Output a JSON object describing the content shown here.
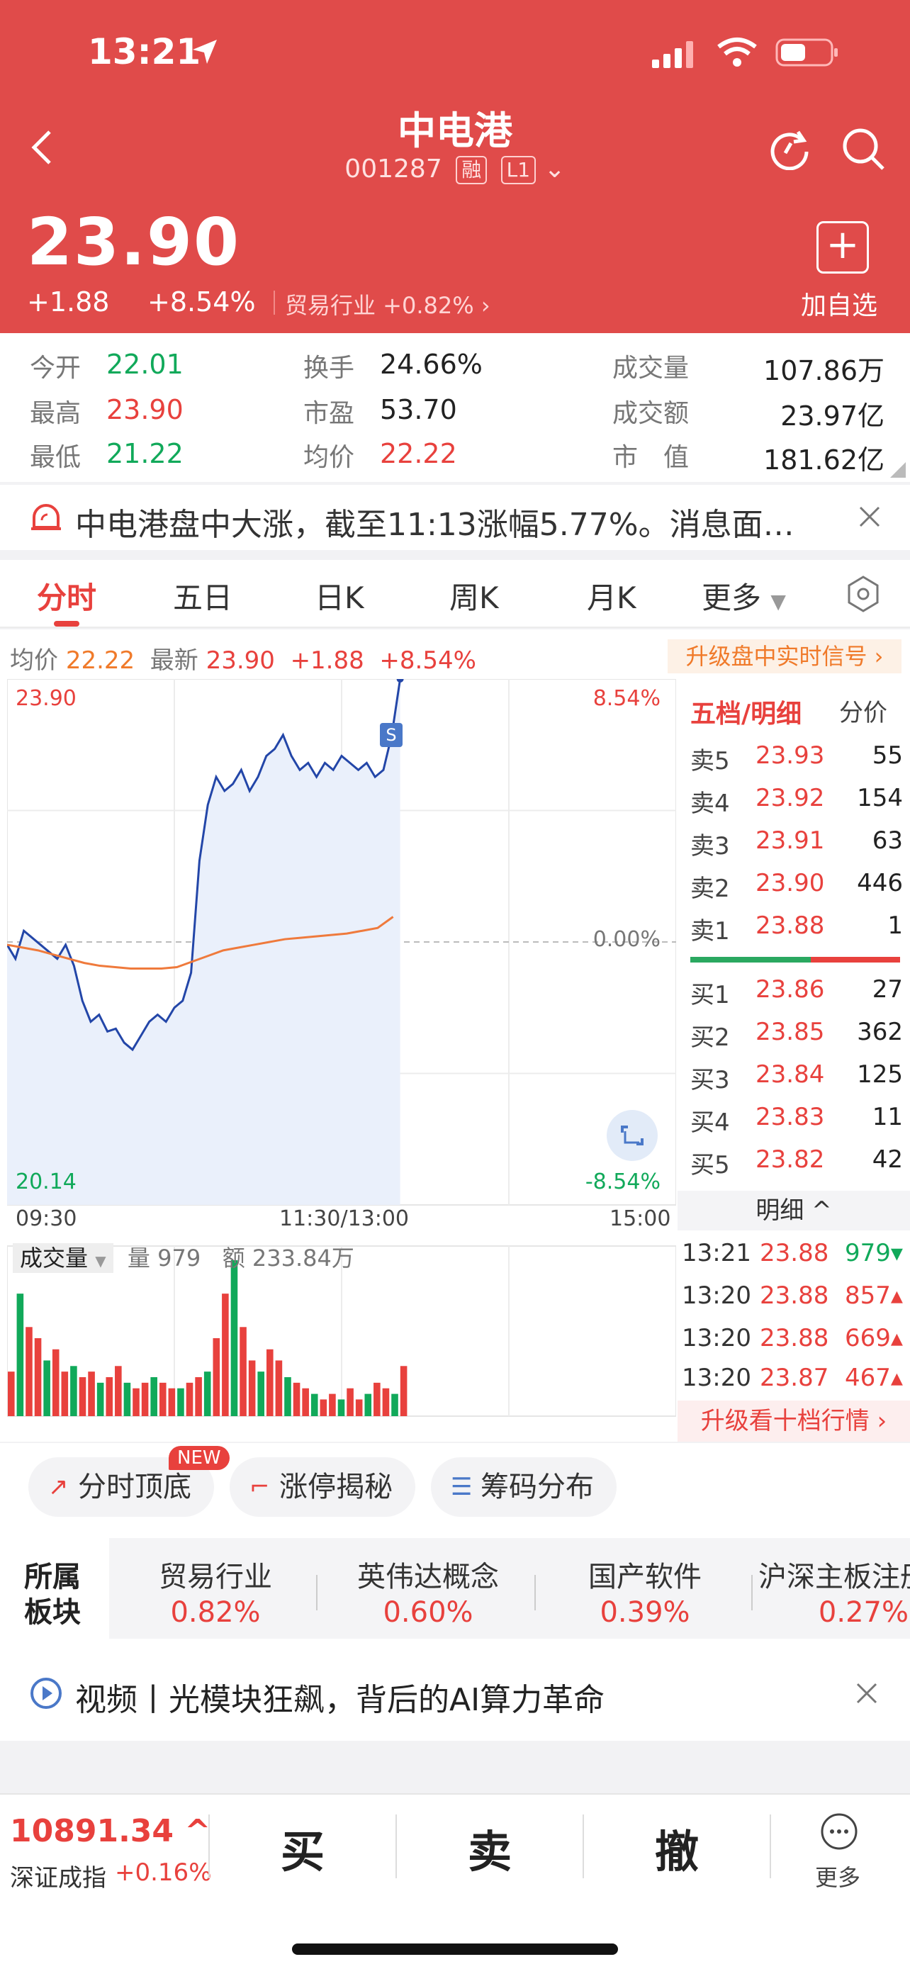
{
  "status_bar": {
    "time": "13:21"
  },
  "header": {
    "title": "中电港",
    "code": "001287",
    "tag_margin": "融",
    "tag_level": "L1",
    "price": "23.90",
    "change": "+1.88",
    "change_pct": "+8.54%",
    "industry_link": "贸易行业 +0.82% ›",
    "add_fav": "加自选"
  },
  "stats": {
    "open_label": "今开",
    "open": "22.01",
    "high_label": "最高",
    "high": "23.90",
    "low_label": "最低",
    "low": "21.22",
    "turnover_label": "换手",
    "turnover": "24.66%",
    "pe_label": "市盈",
    "pe": "53.70",
    "avg_label": "均价",
    "avg": "22.22",
    "volume_label": "成交量",
    "volume": "107.86万",
    "amount_label": "成交额",
    "amount": "23.97亿",
    "mcap_label": "市　值",
    "mcap": "181.62亿"
  },
  "news": {
    "text": "中电港盘中大涨，截至11:13涨幅5.77%。消息面…"
  },
  "tabs": [
    "分时",
    "五日",
    "日K",
    "周K",
    "月K",
    "更多"
  ],
  "chart_info": {
    "avg_label": "均价",
    "avg": "22.22",
    "last_label": "最新",
    "last": "23.90",
    "change": "+1.88",
    "pct": "+8.54%",
    "upgrade": "升级盘中实时信号 ›"
  },
  "chart_data": {
    "type": "line",
    "title": "",
    "ylim": [
      20.14,
      23.9
    ],
    "y_labels_left": [
      "23.90",
      "20.14"
    ],
    "y_labels_right": [
      "8.54%",
      "0.00%",
      "-8.54%"
    ],
    "x_labels": [
      "09:30",
      "11:30/13:00",
      "15:00"
    ],
    "prev_close": 22.02,
    "series": [
      {
        "values": [
          22.0,
          21.9,
          22.1,
          22.05,
          22.0,
          21.95,
          21.9,
          22.0,
          21.85,
          21.6,
          21.45,
          21.5,
          21.38,
          21.4,
          21.3,
          21.25,
          21.35,
          21.45,
          21.5,
          21.45,
          21.55,
          21.6,
          21.8,
          22.6,
          23.0,
          23.2,
          23.1,
          23.15,
          23.25,
          23.1,
          23.2,
          23.35,
          23.4,
          23.5,
          23.35,
          23.25,
          23.3,
          23.2,
          23.3,
          23.25,
          23.35,
          23.3,
          23.25,
          23.3,
          23.2,
          23.25,
          23.5,
          23.9
        ]
      },
      {
        "values": [
          22.0,
          21.98,
          21.96,
          21.93,
          21.9,
          21.87,
          21.85,
          21.84,
          21.83,
          21.83,
          21.83,
          21.84,
          21.88,
          21.92,
          21.96,
          21.98,
          22.0,
          22.02,
          22.04,
          22.05,
          22.06,
          22.07,
          22.08,
          22.1,
          22.12,
          22.2
        ]
      }
    ],
    "volume_bars": [
      8,
      22,
      16,
      14,
      10,
      12,
      8,
      9,
      7,
      8,
      6,
      7,
      9,
      6,
      5,
      6,
      7,
      6,
      5,
      5,
      6,
      7,
      8,
      14,
      22,
      28,
      16,
      10,
      8,
      12,
      10,
      7,
      6,
      5,
      4,
      3,
      4,
      3,
      5,
      3,
      4,
      6,
      5,
      4,
      9
    ]
  },
  "volume_panel": {
    "label": "成交量",
    "qty_label": "量",
    "qty": "979",
    "amt_label": "额",
    "amt": "233.84万"
  },
  "order_book": {
    "head": "五档/明细",
    "head_right": "分价",
    "asks": [
      {
        "label": "卖5",
        "price": "23.93",
        "vol": "55"
      },
      {
        "label": "卖4",
        "price": "23.92",
        "vol": "154"
      },
      {
        "label": "卖3",
        "price": "23.91",
        "vol": "63"
      },
      {
        "label": "卖2",
        "price": "23.90",
        "vol": "446"
      },
      {
        "label": "卖1",
        "price": "23.88",
        "vol": "1"
      }
    ],
    "bids": [
      {
        "label": "买1",
        "price": "23.86",
        "vol": "27"
      },
      {
        "label": "买2",
        "price": "23.85",
        "vol": "362"
      },
      {
        "label": "买3",
        "price": "23.84",
        "vol": "125"
      },
      {
        "label": "买4",
        "price": "23.83",
        "vol": "11"
      },
      {
        "label": "买5",
        "price": "23.82",
        "vol": "42"
      }
    ],
    "detail_head": "明细 ^",
    "ticks": [
      {
        "time": "13:21",
        "price": "23.88",
        "vol": "979▾",
        "color": "#11a95a"
      },
      {
        "time": "13:20",
        "price": "23.88",
        "vol": "857▴",
        "color": "#e8413d"
      },
      {
        "time": "13:20",
        "price": "23.88",
        "vol": "669▴",
        "color": "#e8413d"
      },
      {
        "time": "13:20",
        "price": "23.87",
        "vol": "467▴",
        "color": "#e8413d"
      }
    ],
    "upgrade": "升级看十档行情 ›"
  },
  "tools": {
    "chip1": "分时顶底",
    "chip2": "涨停揭秘",
    "chip3": "筹码分布",
    "new_badge": "NEW"
  },
  "sectors": {
    "title": "所属板块",
    "items": [
      {
        "name": "贸易行业",
        "pct": "0.82%"
      },
      {
        "name": "英伟达概念",
        "pct": "0.60%"
      },
      {
        "name": "国产软件",
        "pct": "0.39%"
      },
      {
        "name": "沪深主板注册",
        "pct": "0.27%"
      }
    ]
  },
  "video": {
    "text": "视频丨光模块狂飙，背后的AI算力革命"
  },
  "bottom": {
    "index_value": "10891.34 ^",
    "index_name": "深证成指",
    "index_pct": "+0.16%",
    "buy": "买",
    "sell": "卖",
    "cancel": "撤",
    "more": "更多"
  }
}
